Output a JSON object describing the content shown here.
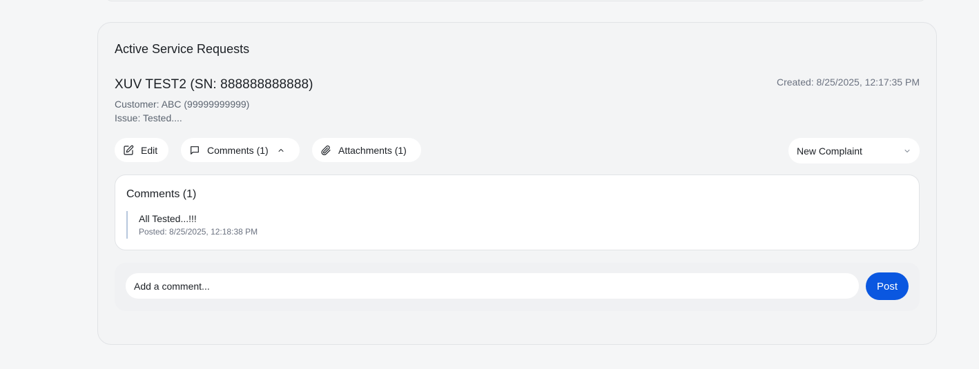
{
  "panel": {
    "title": "Active Service Requests"
  },
  "request": {
    "title": "XUV TEST2 (SN: 888888888888)",
    "created": "Created: 8/25/2025, 12:17:35 PM",
    "customer": "Customer: ABC (99999999999)",
    "issue": "Issue: Tested...."
  },
  "actions": {
    "edit_label": "Edit",
    "comments_label": "Comments (1)",
    "attachments_label": "Attachments (1)",
    "icons": [
      "edit-icon",
      "comment-icon",
      "chevron-up-icon",
      "paperclip-icon",
      "chevron-down-icon"
    ]
  },
  "status_select": {
    "value": "New Complaint"
  },
  "comments": {
    "heading": "Comments (1)",
    "items": [
      {
        "text": "All Tested...!!!",
        "posted": "Posted: 8/25/2025, 12:18:38 PM"
      }
    ]
  },
  "composer": {
    "placeholder": "Add a comment...",
    "post_label": "Post",
    "post_color": "#0a57e0"
  }
}
